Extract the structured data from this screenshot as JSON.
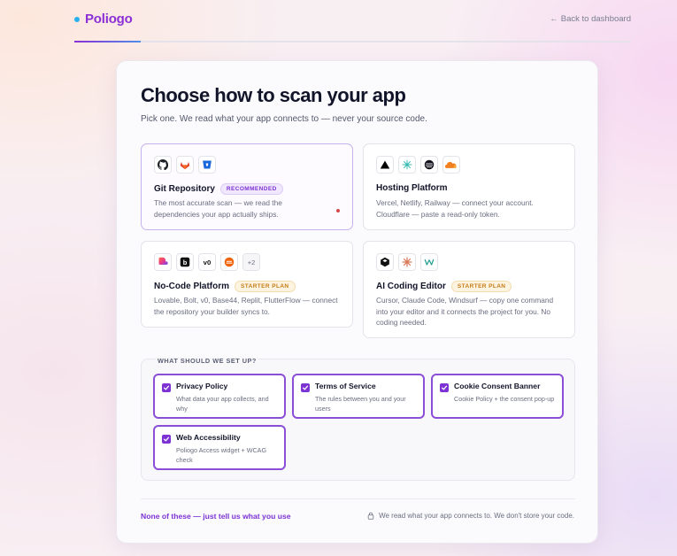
{
  "brand": {
    "name": "Poliogo"
  },
  "nav": {
    "back_link": "Back to dashboard"
  },
  "progress": {
    "fraction": 0.12
  },
  "main": {
    "title": "Choose how to scan your app",
    "subtitle": "Pick one. We read what your app connects to — never your source code."
  },
  "options": [
    {
      "title": "Git Repository",
      "badge": "RECOMMENDED",
      "description": "The most accurate scan — we read the dependencies your app actually ships.",
      "icons": [
        "github-icon",
        "gitlab-icon",
        "bitbucket-icon"
      ],
      "selected": true
    },
    {
      "title": "Hosting Platform",
      "badge": "",
      "description": "Vercel, Netlify, Railway — connect your account. Cloudflare — paste a read-only token.",
      "icons": [
        "vercel-icon",
        "netlify-icon",
        "railway-icon",
        "cloudflare-icon"
      ],
      "selected": false
    },
    {
      "title": "No-Code Platform",
      "badge": "STARTER PLAN",
      "description": "Lovable, Bolt, v0, Base44, Replit, FlutterFlow — connect the repository your builder syncs to.",
      "icons": [
        "lovable-icon",
        "bolt-icon",
        "v0-icon",
        "replit-icon"
      ],
      "more": "+2",
      "selected": false
    },
    {
      "title": "AI Coding Editor",
      "badge": "STARTER PLAN",
      "description": "Cursor, Claude Code, Windsurf — copy one command into your editor and it connects the project for you. No coding needed.",
      "icons": [
        "cursor-icon",
        "claude-icon",
        "windsurf-icon"
      ],
      "selected": false
    }
  ],
  "setup": {
    "heading": "WHAT SHOULD WE SET UP?",
    "items": [
      {
        "title": "Privacy Policy",
        "description": "What data your app collects, and why",
        "checked": true
      },
      {
        "title": "Terms of Service",
        "description": "The rules between you and your users",
        "checked": true
      },
      {
        "title": "Cookie Consent Banner",
        "description": "Cookie Policy + the consent pop-up",
        "checked": true
      },
      {
        "title": "Web Accessibility",
        "description": "Poliogo Access widget + WCAG check",
        "checked": true
      }
    ]
  },
  "footer": {
    "link": "None of these — just tell us what you use",
    "note": "We read what your app connects to. We don't store your code."
  },
  "colors": {
    "accent": "#7d33d3",
    "brand_dot": "#27b0ee",
    "starter_badge": "#c47c16"
  }
}
